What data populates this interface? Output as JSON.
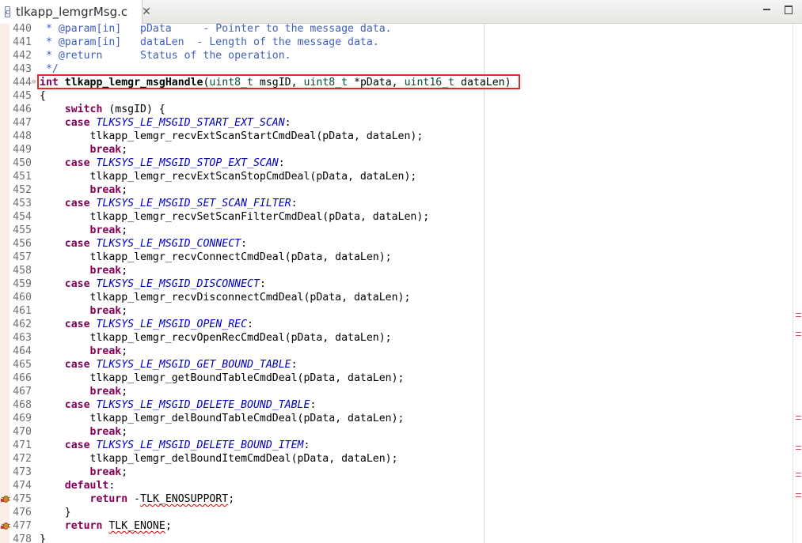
{
  "tab": {
    "file_name": "tlkapp_lemgrMsg.c",
    "file_icon_glyph": "c",
    "close_glyph": "✕"
  },
  "window_controls": [
    "minimize",
    "maximize"
  ],
  "editor": {
    "highlight_line": "444",
    "lines": [
      {
        "n": "440",
        "parts": [
          {
            "t": " * @param[in]   pData     - Pointer to the message data.",
            "c": "cm"
          }
        ]
      },
      {
        "n": "441",
        "parts": [
          {
            "t": " * @param[in]   dataLen  - Length of the message data.",
            "c": "cm"
          }
        ]
      },
      {
        "n": "442",
        "parts": [
          {
            "t": " * @return      Status of the operation.",
            "c": "cm"
          }
        ]
      },
      {
        "n": "443",
        "parts": [
          {
            "t": " */",
            "c": "cm"
          }
        ]
      },
      {
        "n": "444",
        "fold": true,
        "parts": [
          {
            "t": "int",
            "c": "kw"
          },
          {
            "t": " "
          },
          {
            "t": "tlkapp_lemgr_msgHandle",
            "c": "bd"
          },
          {
            "t": "("
          },
          {
            "t": "uint8_t",
            "c": "ty"
          },
          {
            "t": " msgID, "
          },
          {
            "t": "uint8_t",
            "c": "ty"
          },
          {
            "t": " *pData, "
          },
          {
            "t": "uint16_t",
            "c": "ty"
          },
          {
            "t": " dataLen)"
          }
        ]
      },
      {
        "n": "445",
        "parts": [
          {
            "t": "{"
          }
        ]
      },
      {
        "n": "446",
        "parts": [
          {
            "t": "    "
          },
          {
            "t": "switch",
            "c": "kw"
          },
          {
            "t": " (msgID) {"
          }
        ]
      },
      {
        "n": "447",
        "parts": [
          {
            "t": "    "
          },
          {
            "t": "case",
            "c": "kw"
          },
          {
            "t": " "
          },
          {
            "t": "TLKSYS_LE_MSGID_START_EXT_SCAN",
            "c": "en"
          },
          {
            "t": ":"
          }
        ]
      },
      {
        "n": "448",
        "parts": [
          {
            "t": "        tlkapp_lemgr_recvExtScanStartCmdDeal(pData, dataLen);"
          }
        ]
      },
      {
        "n": "449",
        "parts": [
          {
            "t": "        "
          },
          {
            "t": "break",
            "c": "kw"
          },
          {
            "t": ";"
          }
        ]
      },
      {
        "n": "450",
        "parts": [
          {
            "t": "    "
          },
          {
            "t": "case",
            "c": "kw"
          },
          {
            "t": " "
          },
          {
            "t": "TLKSYS_LE_MSGID_STOP_EXT_SCAN",
            "c": "en"
          },
          {
            "t": ":"
          }
        ]
      },
      {
        "n": "451",
        "parts": [
          {
            "t": "        tlkapp_lemgr_recvExtScanStopCmdDeal(pData, dataLen);"
          }
        ]
      },
      {
        "n": "452",
        "parts": [
          {
            "t": "        "
          },
          {
            "t": "break",
            "c": "kw"
          },
          {
            "t": ";"
          }
        ]
      },
      {
        "n": "453",
        "parts": [
          {
            "t": "    "
          },
          {
            "t": "case",
            "c": "kw"
          },
          {
            "t": " "
          },
          {
            "t": "TLKSYS_LE_MSGID_SET_SCAN_FILTER",
            "c": "en"
          },
          {
            "t": ":"
          }
        ]
      },
      {
        "n": "454",
        "parts": [
          {
            "t": "        tlkapp_lemgr_recvSetScanFilterCmdDeal(pData, dataLen);"
          }
        ]
      },
      {
        "n": "455",
        "parts": [
          {
            "t": "        "
          },
          {
            "t": "break",
            "c": "kw"
          },
          {
            "t": ";"
          }
        ]
      },
      {
        "n": "456",
        "parts": [
          {
            "t": "    "
          },
          {
            "t": "case",
            "c": "kw"
          },
          {
            "t": " "
          },
          {
            "t": "TLKSYS_LE_MSGID_CONNECT",
            "c": "en"
          },
          {
            "t": ":"
          }
        ]
      },
      {
        "n": "457",
        "parts": [
          {
            "t": "        tlkapp_lemgr_recvConnectCmdDeal(pData, dataLen);"
          }
        ]
      },
      {
        "n": "458",
        "parts": [
          {
            "t": "        "
          },
          {
            "t": "break",
            "c": "kw"
          },
          {
            "t": ";"
          }
        ]
      },
      {
        "n": "459",
        "parts": [
          {
            "t": "    "
          },
          {
            "t": "case",
            "c": "kw"
          },
          {
            "t": " "
          },
          {
            "t": "TLKSYS_LE_MSGID_DISCONNECT",
            "c": "en"
          },
          {
            "t": ":"
          }
        ]
      },
      {
        "n": "460",
        "parts": [
          {
            "t": "        tlkapp_lemgr_recvDisconnectCmdDeal(pData, dataLen);"
          }
        ]
      },
      {
        "n": "461",
        "parts": [
          {
            "t": "        "
          },
          {
            "t": "break",
            "c": "kw"
          },
          {
            "t": ";"
          }
        ]
      },
      {
        "n": "462",
        "parts": [
          {
            "t": "    "
          },
          {
            "t": "case",
            "c": "kw"
          },
          {
            "t": " "
          },
          {
            "t": "TLKSYS_LE_MSGID_OPEN_REC",
            "c": "en"
          },
          {
            "t": ":"
          }
        ]
      },
      {
        "n": "463",
        "parts": [
          {
            "t": "        tlkapp_lemgr_recvOpenRecCmdDeal(pData, dataLen);"
          }
        ]
      },
      {
        "n": "464",
        "parts": [
          {
            "t": "        "
          },
          {
            "t": "break",
            "c": "kw"
          },
          {
            "t": ";"
          }
        ]
      },
      {
        "n": "465",
        "parts": [
          {
            "t": "    "
          },
          {
            "t": "case",
            "c": "kw"
          },
          {
            "t": " "
          },
          {
            "t": "TLKSYS_LE_MSGID_GET_BOUND_TABLE",
            "c": "en"
          },
          {
            "t": ":"
          }
        ]
      },
      {
        "n": "466",
        "parts": [
          {
            "t": "        tlkapp_lemgr_getBoundTableCmdDeal(pData, dataLen);"
          }
        ]
      },
      {
        "n": "467",
        "parts": [
          {
            "t": "        "
          },
          {
            "t": "break",
            "c": "kw"
          },
          {
            "t": ";"
          }
        ]
      },
      {
        "n": "468",
        "parts": [
          {
            "t": "    "
          },
          {
            "t": "case",
            "c": "kw"
          },
          {
            "t": " "
          },
          {
            "t": "TLKSYS_LE_MSGID_DELETE_BOUND_TABLE",
            "c": "en"
          },
          {
            "t": ":"
          }
        ]
      },
      {
        "n": "469",
        "parts": [
          {
            "t": "        tlkapp_lemgr_delBoundTableCmdDeal(pData, dataLen);"
          }
        ]
      },
      {
        "n": "470",
        "parts": [
          {
            "t": "        "
          },
          {
            "t": "break",
            "c": "kw"
          },
          {
            "t": ";"
          }
        ]
      },
      {
        "n": "471",
        "parts": [
          {
            "t": "    "
          },
          {
            "t": "case",
            "c": "kw"
          },
          {
            "t": " "
          },
          {
            "t": "TLKSYS_LE_MSGID_DELETE_BOUND_ITEM",
            "c": "en"
          },
          {
            "t": ":"
          }
        ]
      },
      {
        "n": "472",
        "parts": [
          {
            "t": "        tlkapp_lemgr_delBoundItemCmdDeal(pData, dataLen);"
          }
        ]
      },
      {
        "n": "473",
        "parts": [
          {
            "t": "        "
          },
          {
            "t": "break",
            "c": "kw"
          },
          {
            "t": ";"
          }
        ]
      },
      {
        "n": "474",
        "parts": [
          {
            "t": "    "
          },
          {
            "t": "default",
            "c": "kw"
          },
          {
            "t": ":"
          }
        ]
      },
      {
        "n": "475",
        "warn": true,
        "parts": [
          {
            "t": "        "
          },
          {
            "t": "return",
            "c": "kw"
          },
          {
            "t": " -"
          },
          {
            "t": "TLK_ENOSUPPORT",
            "c": "sq"
          },
          {
            "t": ";"
          }
        ]
      },
      {
        "n": "476",
        "parts": [
          {
            "t": "    }"
          }
        ]
      },
      {
        "n": "477",
        "warn": true,
        "parts": [
          {
            "t": "    "
          },
          {
            "t": "return",
            "c": "kw"
          },
          {
            "t": " "
          },
          {
            "t": "TLK_ENONE",
            "c": "sq"
          },
          {
            "t": ";"
          }
        ]
      },
      {
        "n": "478",
        "parts": [
          {
            "t": "}"
          }
        ]
      }
    ]
  },
  "colors": {
    "comment": "#3f5fbf",
    "keyword": "#7f0055",
    "type": "#005032",
    "enum": "#0000c0",
    "highlight_box": "#e02b2b",
    "error_marker": "#e04b4b"
  },
  "overview_marks": [
    "error",
    "error",
    "error",
    "error",
    "error",
    "error",
    "error"
  ],
  "icons": [
    "c-file-icon",
    "close-icon",
    "minimize-icon",
    "maximize-icon",
    "fold-icon",
    "warning-bug-icon"
  ]
}
